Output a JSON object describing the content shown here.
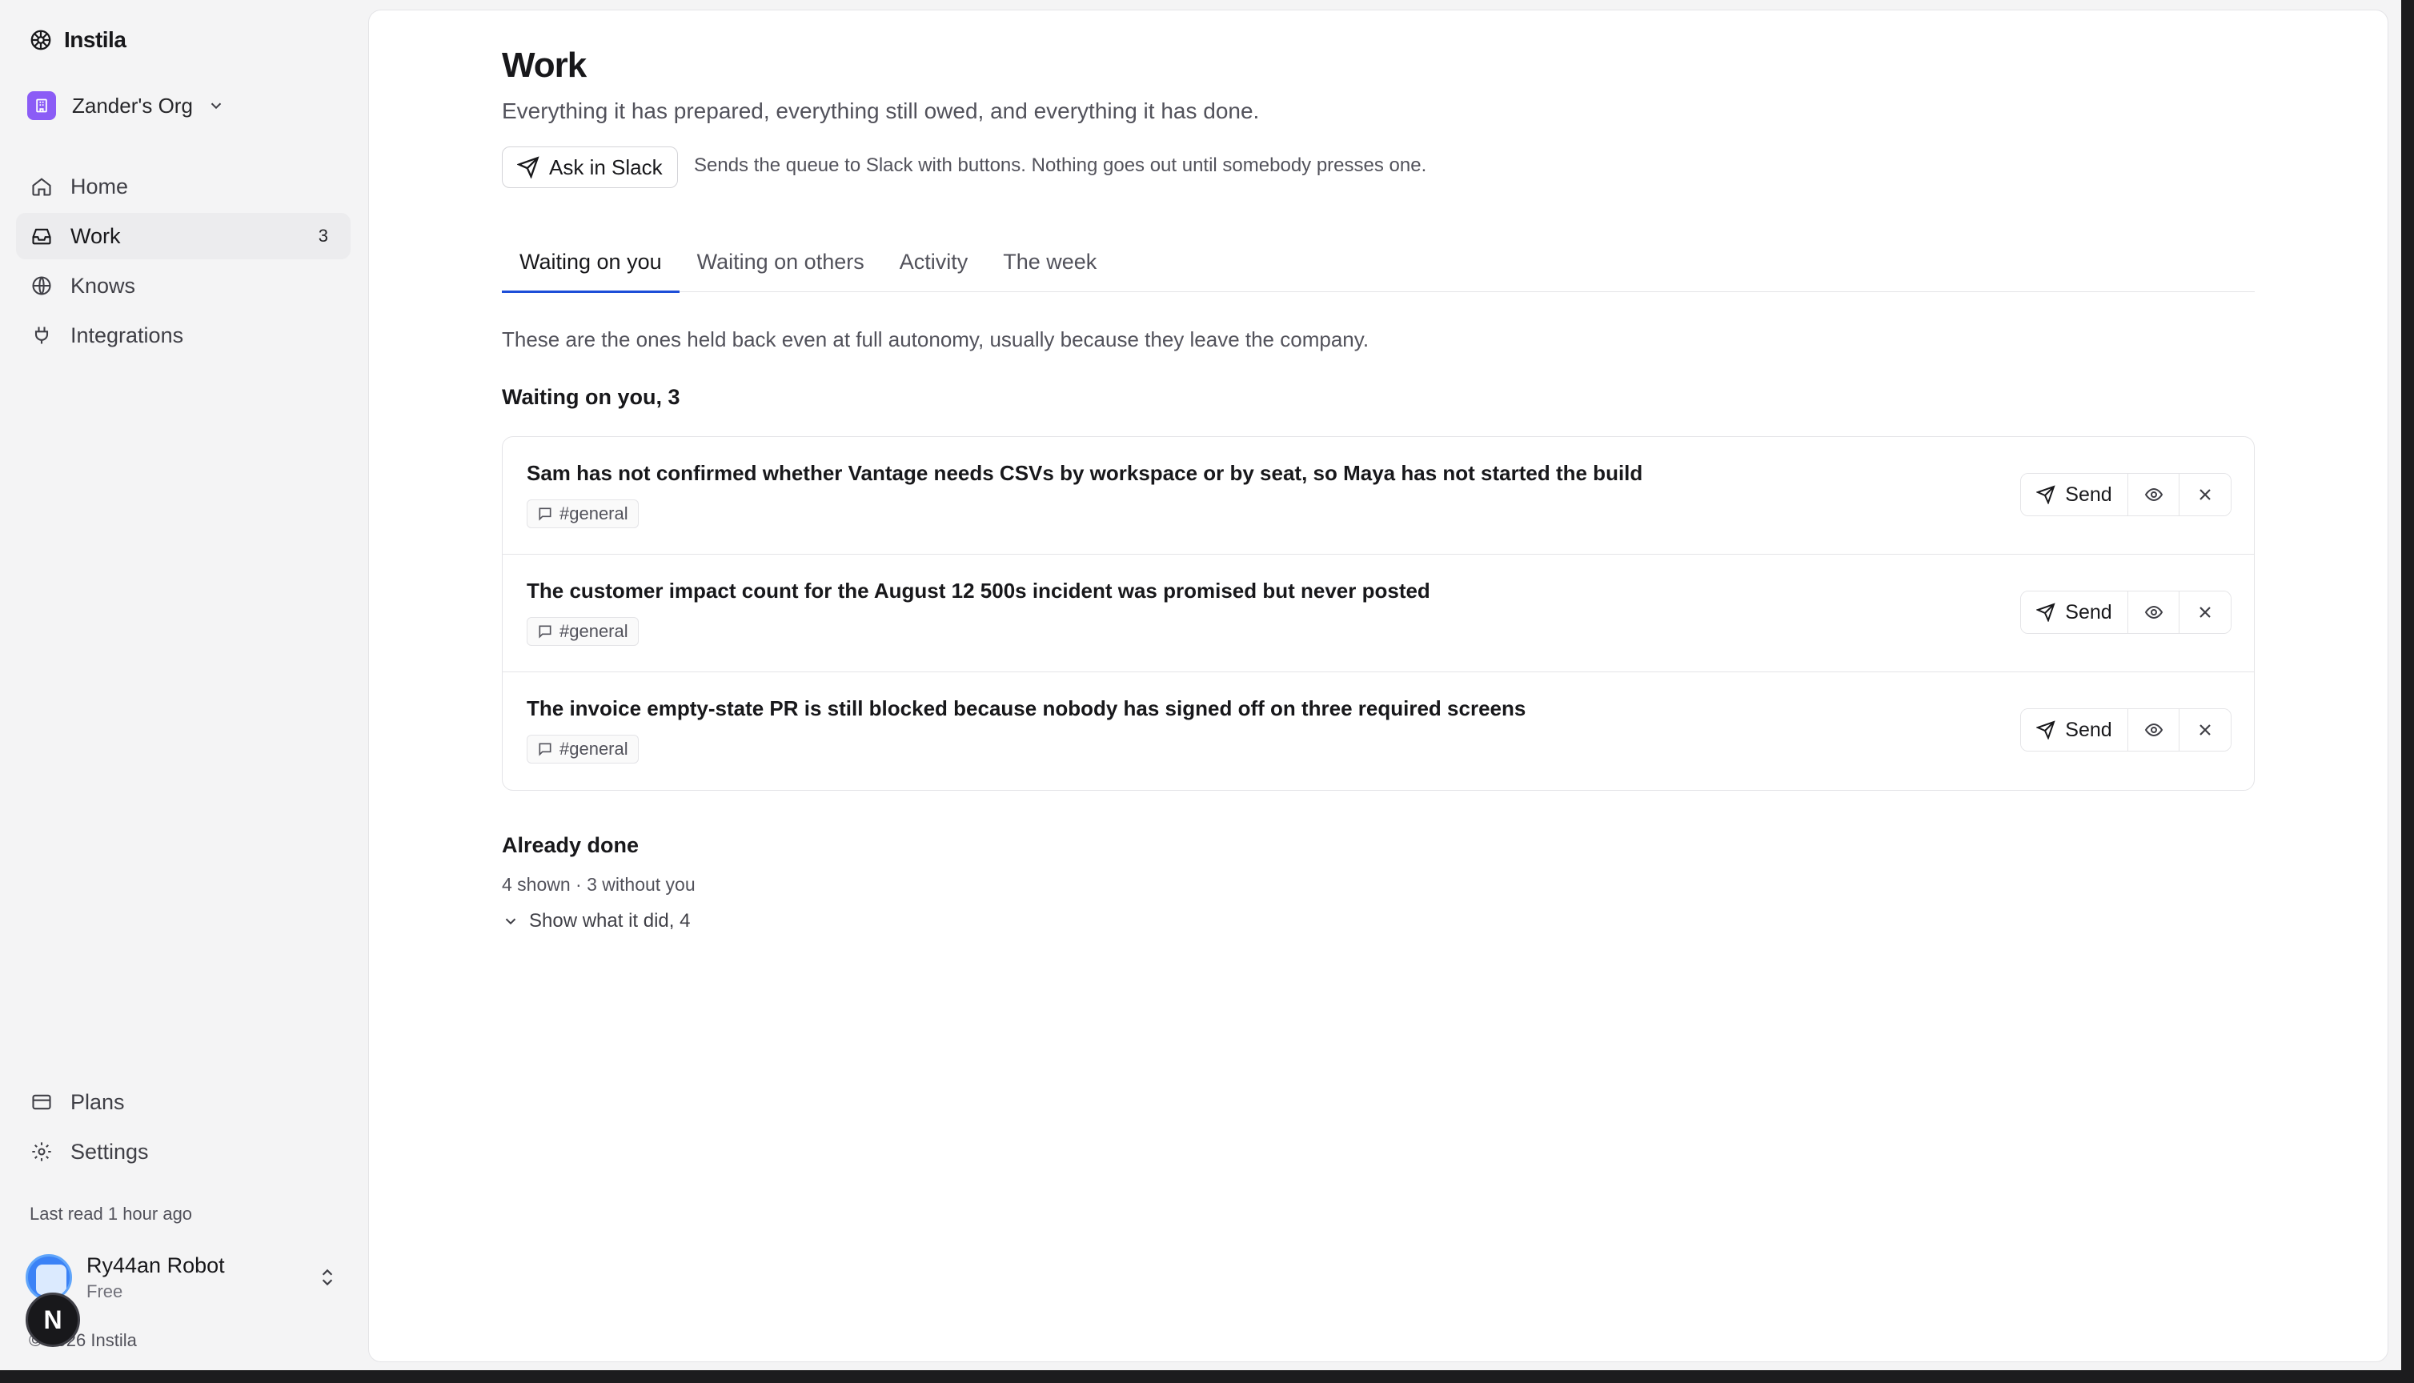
{
  "app": {
    "name": "Instila"
  },
  "org": {
    "name": "Zander's Org"
  },
  "nav": {
    "items": [
      {
        "label": "Home"
      },
      {
        "label": "Work",
        "count": "3"
      },
      {
        "label": "Knows"
      },
      {
        "label": "Integrations"
      }
    ],
    "bottom": [
      {
        "label": "Plans"
      },
      {
        "label": "Settings"
      }
    ]
  },
  "sidebar_footer": {
    "last_read": "Last read 1 hour ago",
    "user_name": "Ry44an Robot",
    "user_plan": "Free",
    "fab_label": "N",
    "copyright": "© 2026 Instila"
  },
  "page": {
    "title": "Work",
    "subtitle": "Everything it has prepared, everything still owed, and everything it has done.",
    "slack_button": "Ask in Slack",
    "slack_note": "Sends the queue to Slack with buttons. Nothing goes out until somebody presses one."
  },
  "tabs": [
    {
      "label": "Waiting on you",
      "active": true
    },
    {
      "label": "Waiting on others"
    },
    {
      "label": "Activity"
    },
    {
      "label": "The week"
    }
  ],
  "waiting": {
    "explain": "These are the ones held back even at full autonomy, usually because they leave the company.",
    "heading": "Waiting on you, 3",
    "items": [
      {
        "title": "Sam has not confirmed whether Vantage needs CSVs by workspace or by seat, so Maya has not started the build",
        "channel": "#general",
        "send_label": "Send"
      },
      {
        "title": "The customer impact count for the August 12 500s incident was promised but never posted",
        "channel": "#general",
        "send_label": "Send"
      },
      {
        "title": "The invoice empty-state PR is still blocked because nobody has signed off on three required screens",
        "channel": "#general",
        "send_label": "Send"
      }
    ]
  },
  "done": {
    "heading": "Already done",
    "meta": "4 shown · 3 without you",
    "toggle": "Show what it did, 4"
  },
  "colors": {
    "accent": "#1d4ed8",
    "org_badge": "#8b5cf6"
  }
}
